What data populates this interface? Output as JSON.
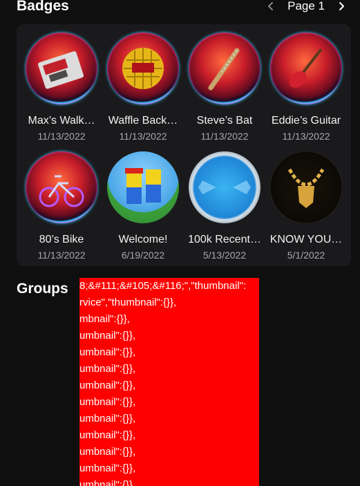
{
  "header": {
    "title": "Badges",
    "page_label": "Page 1"
  },
  "badges": [
    {
      "name": "Max’s Walk…",
      "date": "11/13/2022",
      "icon": "walkman-icon"
    },
    {
      "name": "Waffle Back…",
      "date": "11/13/2022",
      "icon": "waffle-icon"
    },
    {
      "name": "Steve’s Bat",
      "date": "11/13/2022",
      "icon": "bat-icon"
    },
    {
      "name": "Eddie’s Guitar",
      "date": "11/13/2022",
      "icon": "guitar-icon"
    },
    {
      "name": "80’s Bike",
      "date": "11/13/2022",
      "icon": "bike-icon"
    },
    {
      "name": "Welcome!",
      "date": "6/19/2022",
      "icon": "welcome-avatars-icon"
    },
    {
      "name": "100k Recent…",
      "date": "5/13/2022",
      "icon": "100k-icon"
    },
    {
      "name": "KNOW YOU…",
      "date": "5/1/2022",
      "icon": "chain-icon"
    }
  ],
  "groups": {
    "title": "Groups",
    "error_lines": [
      "8;&#111;&#105;&#116;\",\"thumbnail\":",
      "rvice\",\"thumbnail\":{}},",
      "mbnail\":{}},",
      "umbnail\":{}},",
      "umbnail\":{}},",
      "umbnail\":{}},",
      "umbnail\":{}},",
      "umbnail\":{}},",
      "umbnail\":{}},",
      "umbnail\":{}},",
      "umbnail\":{}},",
      "umbnail\":{}},",
      "umbnail\":{}},"
    ],
    "error_bg": "#ff0000"
  },
  "colors": {
    "page_bg": "#0f0f10",
    "panel_bg": "#1a1a1c",
    "date_text": "#a9a9ab"
  }
}
